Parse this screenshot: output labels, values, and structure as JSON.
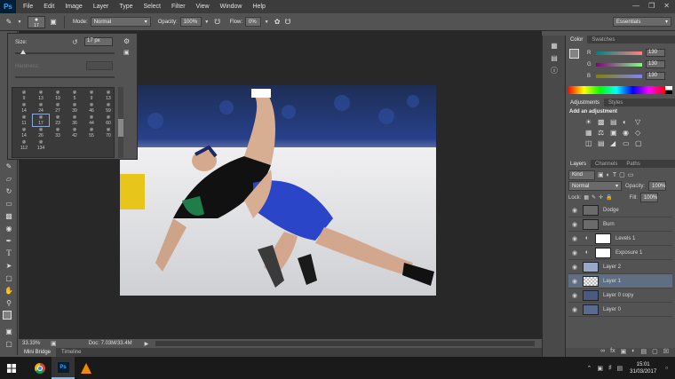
{
  "menu": {
    "logo": "Ps",
    "items": [
      "File",
      "Edit",
      "Image",
      "Layer",
      "Type",
      "Select",
      "Filter",
      "View",
      "Window",
      "Help"
    ]
  },
  "options": {
    "brush_size": "17",
    "mode_label": "Mode:",
    "mode_value": "Normal",
    "opacity_label": "Opacity:",
    "opacity_value": "100%",
    "flow_label": "Flow:",
    "flow_value": "0%",
    "workspace": "Essentials"
  },
  "brush_panel": {
    "size_label": "Size:",
    "size_value": "17 px",
    "hardness_label": "Hardness:",
    "preset_sizes": [
      "9",
      "13",
      "19",
      "5",
      "9",
      "13",
      "14",
      "24",
      "27",
      "39",
      "46",
      "59",
      "11",
      "17",
      "23",
      "36",
      "44",
      "60",
      "14",
      "26",
      "33",
      "42",
      "55",
      "70",
      "112",
      "134"
    ]
  },
  "status": {
    "zoom": "33.33%",
    "doc": "Doc: 7.03M/33.4M"
  },
  "bottom_tabs": [
    "Mini Bridge",
    "Timeline"
  ],
  "color_panel": {
    "tabs": [
      "Color",
      "Swatches"
    ],
    "channels": [
      {
        "label": "R",
        "value": "130"
      },
      {
        "label": "G",
        "value": "130"
      },
      {
        "label": "B",
        "value": "130"
      }
    ]
  },
  "adjustments_panel": {
    "tabs": [
      "Adjustments",
      "Styles"
    ],
    "heading": "Add an adjustment"
  },
  "layers_panel": {
    "tabs": [
      "Layers",
      "Channels",
      "Paths"
    ],
    "kind_label": "Kind",
    "blend_mode": "Normal",
    "opacity_label": "Opacity:",
    "opacity_value": "100%",
    "lock_label": "Lock:",
    "fill_label": "Fill:",
    "fill_value": "100%",
    "layers": [
      {
        "name": "Dodge"
      },
      {
        "name": "Burn"
      },
      {
        "name": "Levels 1"
      },
      {
        "name": "Exposure 1"
      },
      {
        "name": "Layer 2"
      },
      {
        "name": "Layer 1"
      },
      {
        "name": "Layer 0 copy"
      },
      {
        "name": "Layer 0"
      }
    ]
  },
  "taskbar": {
    "time": "15:01",
    "date": "31/03/2017"
  },
  "colors": {
    "ps_blue": "#31a8ff",
    "selection": "#5f6e82",
    "wrestler_blue": "#2a45c8"
  }
}
